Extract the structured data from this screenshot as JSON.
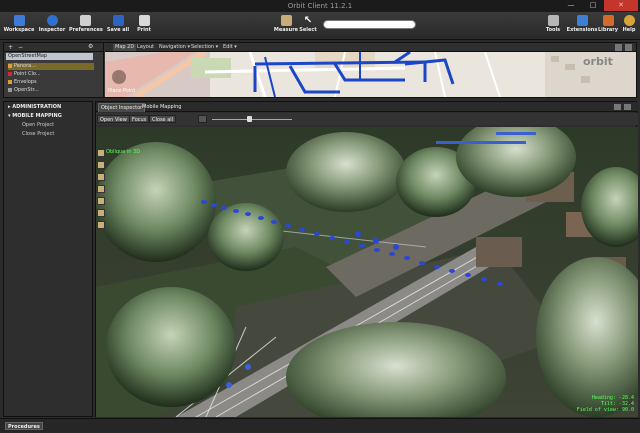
{
  "window": {
    "title": "Orbit Client 11.2.1",
    "minimize": "—",
    "maximize": "□",
    "close": "✕"
  },
  "ribbon": {
    "left": [
      {
        "label": "Workspace",
        "icon": "workspace-icon",
        "color": "#3e7bd6"
      },
      {
        "label": "Inspector",
        "icon": "inspector-icon",
        "color": "#2f6fd0"
      },
      {
        "label": "Preferences",
        "icon": "preferences-icon",
        "color": "#cfcfcf"
      },
      {
        "label": "Save all",
        "icon": "save-icon",
        "color": "#2d65c7"
      },
      {
        "label": "Print",
        "icon": "print-icon",
        "color": "#d9d9d9"
      }
    ],
    "center": [
      {
        "label": "Measure",
        "icon": "measure-icon",
        "color": "#c9ad76"
      },
      {
        "label": "Select",
        "icon": "cursor-icon",
        "color": "#ffffff"
      }
    ],
    "right": [
      {
        "label": "Tools",
        "icon": "tools-icon",
        "color": "#b7b7b7"
      },
      {
        "label": "Extensions",
        "icon": "extensions-icon",
        "color": "#3d7fd6"
      },
      {
        "label": "Library",
        "icon": "library-icon",
        "color": "#d66a2a"
      },
      {
        "label": "Help",
        "icon": "help-icon",
        "color": "#d8a43a"
      }
    ]
  },
  "layers": {
    "root": "OpenStreetMap",
    "items": [
      "Panora...",
      "Point Clo...",
      "Envelops",
      "OpenStr..."
    ]
  },
  "map_toolbar": {
    "map2d": "Map 2D",
    "layout": "Layout",
    "navigation": "Navigation ▾",
    "selection": "Selection ▾",
    "edit": "Edit ▾",
    "place_point": "Place Point"
  },
  "left_panel": {
    "sections": [
      {
        "title": "ADMINISTRATION",
        "items": []
      },
      {
        "title": "MOBILE MAPPING",
        "items": [
          "Open Project",
          "Close Project"
        ]
      }
    ]
  },
  "main_tabs": [
    "Object Inspector",
    "Mobile Mapping"
  ],
  "view_toolbar": {
    "open_view": "Open View",
    "focus": "Focus",
    "close_all": "Close all"
  },
  "view": {
    "title": "Oblique in 3D",
    "hud": {
      "heading": "Heading:  -28.4",
      "tilt": "Tilt:  -32.4",
      "fov": "Field of view:  90.0"
    }
  },
  "status": {
    "procedures": "Procedures"
  },
  "brand": {
    "logo": "orbit"
  }
}
